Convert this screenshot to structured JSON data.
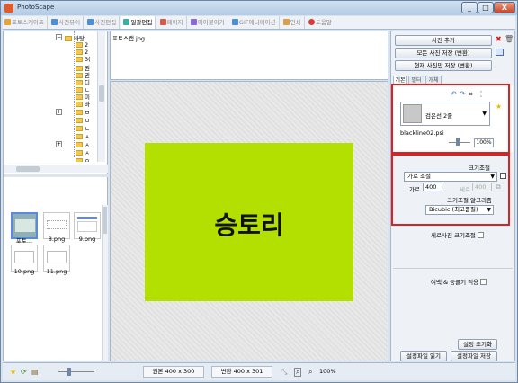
{
  "window": {
    "title": "PhotoScape",
    "controls": [
      "_",
      "□",
      "X"
    ]
  },
  "tabs": [
    {
      "label": "포토스케이프",
      "color": "#e6a23c",
      "active": false
    },
    {
      "label": "사진뷰어",
      "color": "#4a8fd9",
      "active": false
    },
    {
      "label": "사진편집",
      "color": "#4a8fd9",
      "active": false
    },
    {
      "label": "일괄편집",
      "color": "#3ab0a0",
      "active": true
    },
    {
      "label": "페이지",
      "color": "#d95a4a",
      "active": false
    },
    {
      "label": "이어붙이기",
      "color": "#8a6ad9",
      "active": false
    },
    {
      "label": "GIF애니메이션",
      "color": "#4a8fd9",
      "active": false
    },
    {
      "label": "인쇄",
      "color": "#d9a04a",
      "active": false
    },
    {
      "label": "도움말",
      "color": "#d93a3a",
      "active": false
    }
  ],
  "tree": {
    "root_label": "바탕",
    "items": [
      "2",
      "2",
      "3(",
      "권",
      "권",
      "디",
      "ㄴ",
      "미",
      "바",
      "ㅂ",
      "ㅂ",
      "ㄴ",
      "ㅅ",
      "ㅅ",
      "ㅅ",
      "ㅇ"
    ]
  },
  "thumbnails": [
    {
      "label": "포토...",
      "selected": true
    },
    {
      "label": "8.png",
      "selected": false
    },
    {
      "label": "9.png",
      "selected": false
    },
    {
      "label": "10.png",
      "selected": false
    },
    {
      "label": "11.png",
      "selected": false
    }
  ],
  "file_list": {
    "items": [
      "포토스캡.jpg"
    ]
  },
  "preview": {
    "text": "승토리",
    "background": "#b3e000"
  },
  "right_panel": {
    "add_photo": "사진 추가",
    "save_all": "모든 사진 저장 (변환)",
    "save_current": "현재 사진만 저장 (변환)",
    "subtabs": [
      "기본",
      "필터",
      "개체"
    ],
    "frame_name": "검은선 2줄",
    "frame_file": "blackline02.psi",
    "frame_percent": "100%",
    "resize_title": "크기조절",
    "resize_mode": "가로 조절",
    "width_label": "가로",
    "width_value": "400",
    "height_label": "세로",
    "height_value": "400",
    "algorithm_title": "크기조절 알고리즘",
    "algorithm_value": "Bicubic (최고품질)",
    "portrait_resize": "세로사진 크기조절",
    "margin_round": "여백 & 둥글기 적용",
    "reset_settings": "설정 초기화",
    "load_settings": "설정파일 읽기",
    "save_settings": "설정파일 저장"
  },
  "status": {
    "original": "원본 400 x 300",
    "converted": "변환 400 x 301",
    "zoom": "100%"
  }
}
